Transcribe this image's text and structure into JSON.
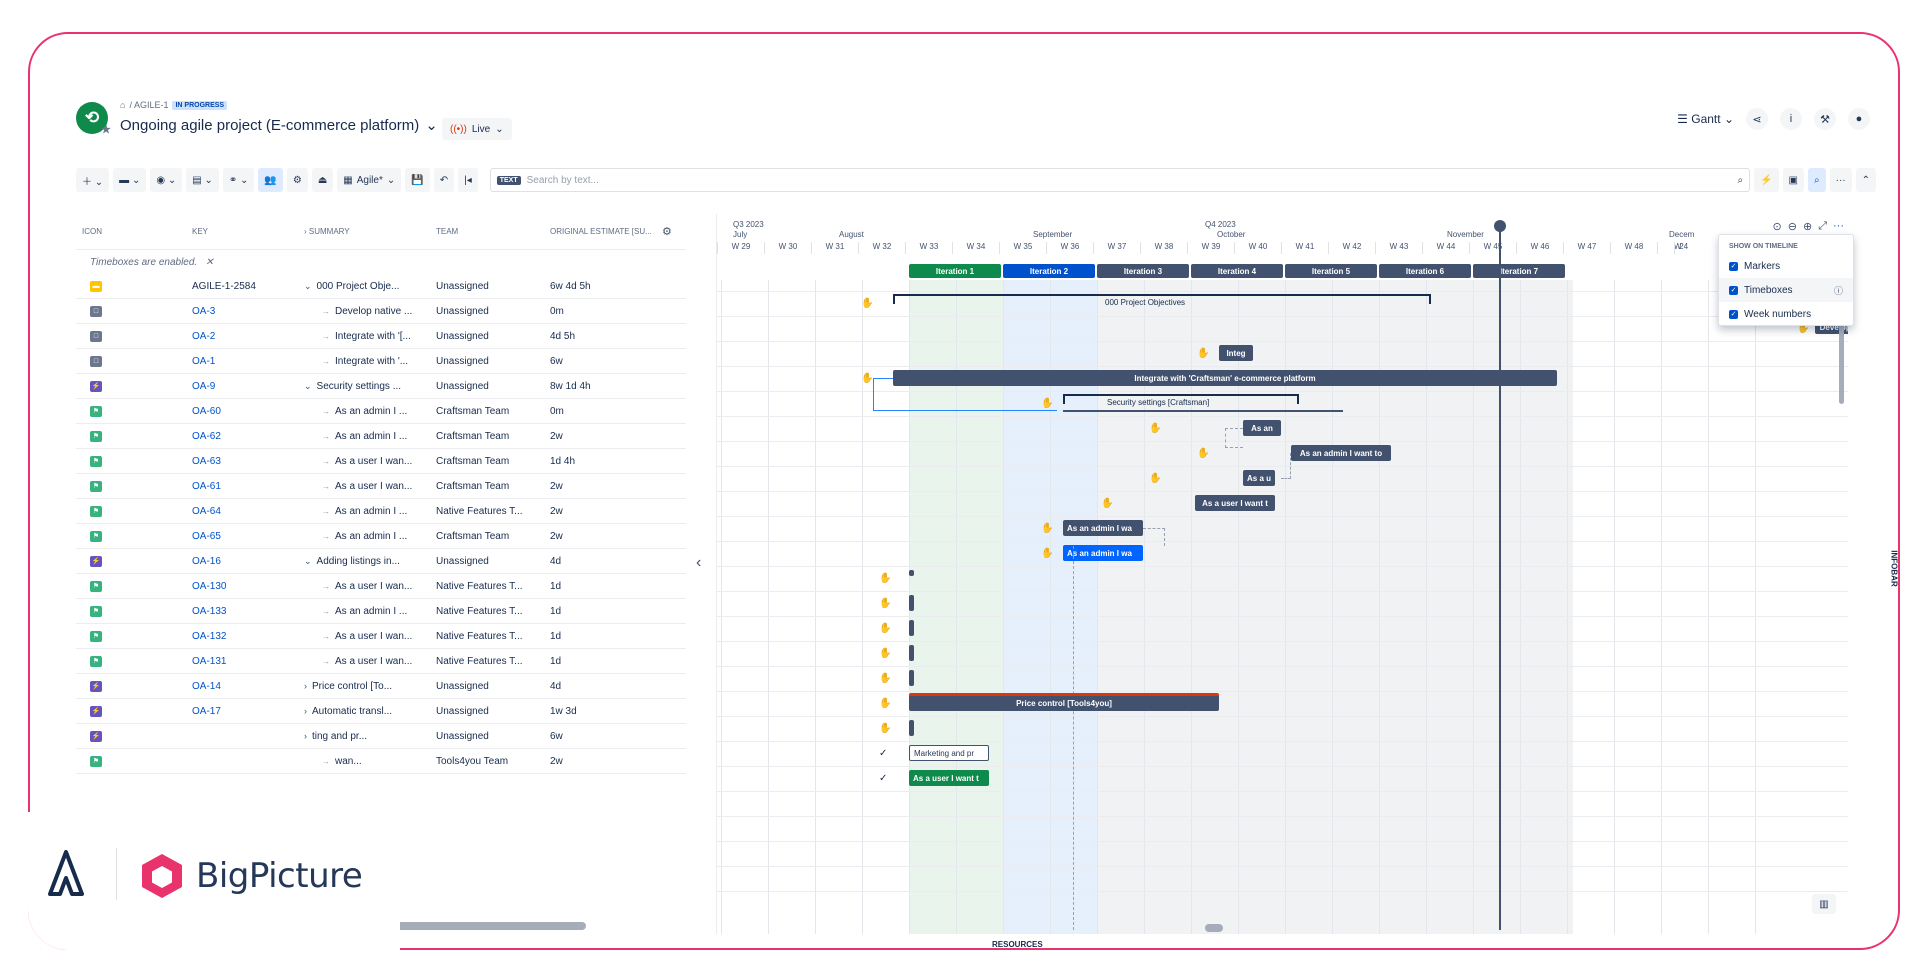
{
  "header": {
    "breadcrumb": "/ AGILE-1",
    "status_badge": "IN PROGRESS",
    "project_title": "Ongoing agile project (E-commerce platform)",
    "live_label": "Live",
    "view_label": "Gantt"
  },
  "toolbar": {
    "agile_label": "Agile*",
    "search_tag": "TEXT",
    "search_placeholder": "Search by text..."
  },
  "grid": {
    "columns": [
      "ICON",
      "KEY",
      "SUMMARY",
      "TEAM",
      "ORIGINAL ESTIMATE [SU..."
    ],
    "timebox_note": "Timeboxes are enabled.",
    "rows": [
      {
        "key": "AGILE-1-2584",
        "summary": "000 Project Obje...",
        "team": "Unassigned",
        "estimate": "6w 4d 5h"
      },
      {
        "key": "OA-3",
        "summary": "Develop native ...",
        "team": "Unassigned",
        "estimate": "0m"
      },
      {
        "key": "OA-2",
        "summary": "Integrate with '[...",
        "team": "Unassigned",
        "estimate": "4d 5h"
      },
      {
        "key": "OA-1",
        "summary": "Integrate with '...",
        "team": "Unassigned",
        "estimate": "6w"
      },
      {
        "key": "OA-9",
        "summary": "Security settings ...",
        "team": "Unassigned",
        "estimate": "8w 1d 4h"
      },
      {
        "key": "OA-60",
        "summary": "As an admin I ...",
        "team": "Craftsman Team",
        "estimate": "0m"
      },
      {
        "key": "OA-62",
        "summary": "As an admin I ...",
        "team": "Craftsman Team",
        "estimate": "2w"
      },
      {
        "key": "OA-63",
        "summary": "As a user I wan...",
        "team": "Craftsman Team",
        "estimate": "1d 4h"
      },
      {
        "key": "OA-61",
        "summary": "As a user I wan...",
        "team": "Craftsman Team",
        "estimate": "2w"
      },
      {
        "key": "OA-64",
        "summary": "As an admin I ...",
        "team": "Native Features T...",
        "estimate": "2w"
      },
      {
        "key": "OA-65",
        "summary": "As an admin I ...",
        "team": "Craftsman Team",
        "estimate": "2w"
      },
      {
        "key": "OA-16",
        "summary": "Adding listings in...",
        "team": "Unassigned",
        "estimate": "4d"
      },
      {
        "key": "OA-130",
        "summary": "As a user I wan...",
        "team": "Native Features T...",
        "estimate": "1d"
      },
      {
        "key": "OA-133",
        "summary": "As an admin I ...",
        "team": "Native Features T...",
        "estimate": "1d"
      },
      {
        "key": "OA-132",
        "summary": "As a user I wan...",
        "team": "Native Features T...",
        "estimate": "1d"
      },
      {
        "key": "OA-131",
        "summary": "As a user I wan...",
        "team": "Native Features T...",
        "estimate": "1d"
      },
      {
        "key": "OA-14",
        "summary": "Price control [To...",
        "team": "Unassigned",
        "estimate": "4d"
      },
      {
        "key": "OA-17",
        "summary": "Automatic transl...",
        "team": "Unassigned",
        "estimate": "1w 3d"
      },
      {
        "key": "",
        "summary": "ting and pr...",
        "team": "Unassigned",
        "estimate": "6w"
      },
      {
        "key": "",
        "summary": "wan...",
        "team": "Tools4you Team",
        "estimate": "2w"
      }
    ]
  },
  "gantt": {
    "quarters": [
      "Q3 2023",
      "Q4 2023"
    ],
    "months": [
      "July",
      "August",
      "September",
      "October",
      "November",
      "Decem"
    ],
    "weeks": [
      "W 29",
      "W 30",
      "W 31",
      "W 32",
      "W 33",
      "W 34",
      "W 35",
      "W 36",
      "W 37",
      "W 38",
      "W 39",
      "W 40",
      "W 41",
      "W 42",
      "W 43",
      "W 44",
      "W 45",
      "W 46",
      "W 47",
      "W 48",
      "W 4",
      "2"
    ],
    "iterations": [
      "Iteration 1",
      "Iteration 2",
      "Iteration 3",
      "Iteration 4",
      "Iteration 5",
      "Iteration 6",
      "Iteration 7"
    ],
    "bars": {
      "project_objectives": "000 Project Objectives",
      "develop": "Develop na",
      "integ_short": "Integ",
      "integrate_full": "Integrate with 'Craftsman' e-commerce platform",
      "security": "Security settings [Craftsman]",
      "as_an_1": "As an",
      "as_admin_want": "As an admin I want to",
      "as_a": "As a u",
      "as_user_want": "As a user I want t",
      "as_admin_wa_1": "As an admin I wa",
      "as_admin_wa_2": "As an admin I wa",
      "price_control": "Price control [Tools4you]",
      "marketing": "Marketing and pr",
      "user_want_green": "As a user I want t"
    },
    "resources_label": "RESOURCES",
    "infobar_label": "INFOBAR"
  },
  "timeline_menu": {
    "heading": "SHOW ON TIMELINE",
    "options": [
      "Markers",
      "Timeboxes",
      "Week numbers"
    ]
  },
  "brand": {
    "name": "BigPicture"
  }
}
